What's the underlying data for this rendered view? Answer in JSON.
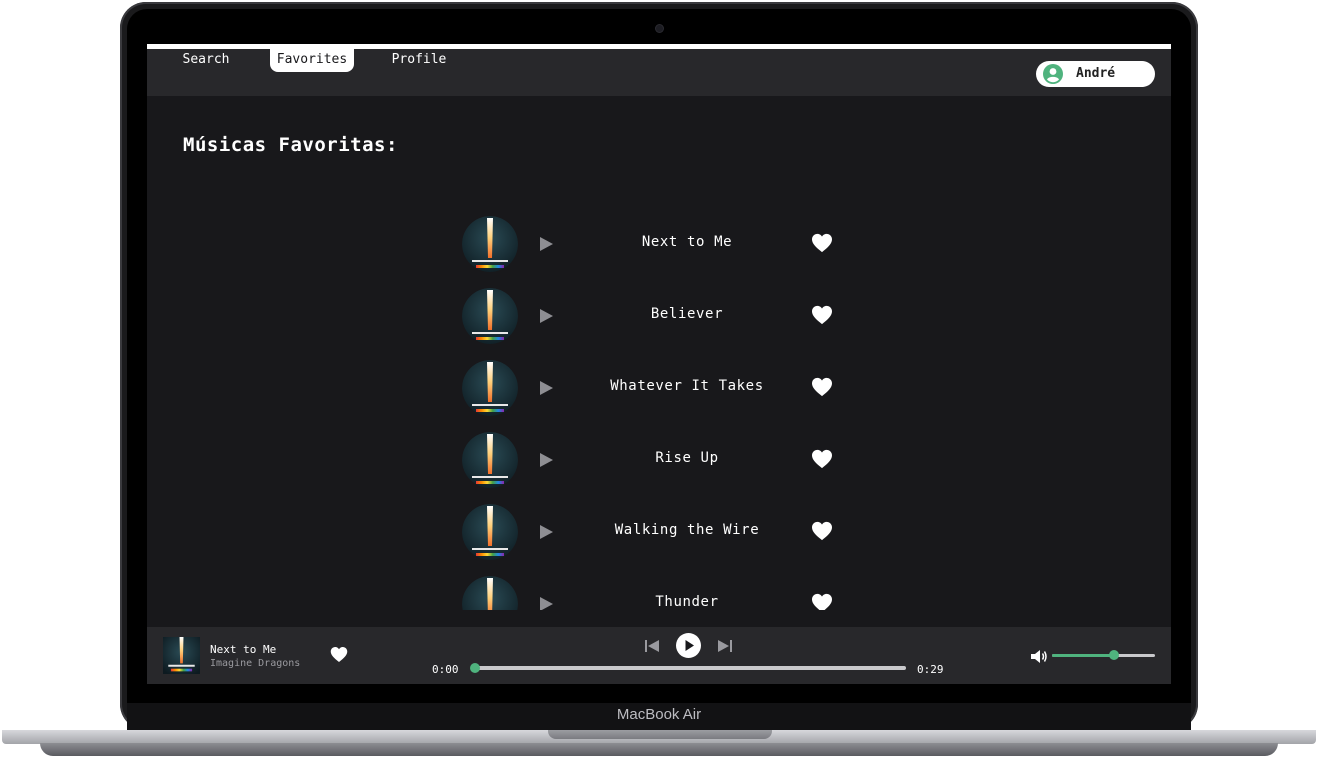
{
  "device": {
    "brand_label": "MacBook Air"
  },
  "nav": {
    "tabs": [
      {
        "label": "Search"
      },
      {
        "label": "Favorites",
        "active": true
      },
      {
        "label": "Profile"
      }
    ],
    "user_name": "André"
  },
  "favorites": {
    "title": "Músicas Favoritas:",
    "songs": [
      {
        "title": "Next to Me"
      },
      {
        "title": "Believer"
      },
      {
        "title": "Whatever It Takes"
      },
      {
        "title": "Rise Up"
      },
      {
        "title": "Walking the Wire"
      },
      {
        "title": "Thunder"
      }
    ]
  },
  "player": {
    "now_playing_title": "Next to Me",
    "now_playing_artist": "Imagine Dragons",
    "current_time": "0:00",
    "total_time": "0:29",
    "progress": 0.0,
    "volume": 0.6
  },
  "colors": {
    "accent": "#4fb37e",
    "background": "#18181b",
    "panel": "#28282b"
  },
  "icons": [
    "user-icon",
    "play-icon",
    "heart-icon",
    "prev-icon",
    "play-pause-icon",
    "next-icon",
    "volume-icon"
  ]
}
